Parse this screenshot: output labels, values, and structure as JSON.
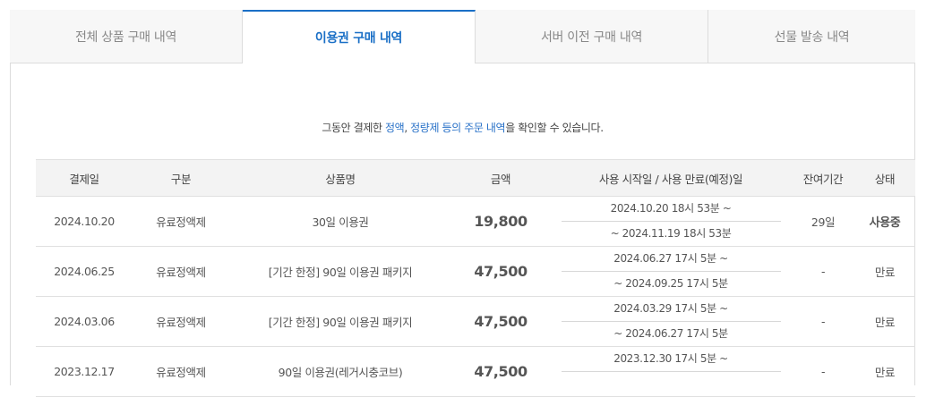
{
  "tabs": [
    {
      "label": "전체 상품 구매 내역",
      "active": false
    },
    {
      "label": "이용권 구매 내역",
      "active": true
    },
    {
      "label": "서버 이전 구매 내역",
      "active": false
    },
    {
      "label": "선물 발송 내역",
      "active": false
    }
  ],
  "notice": {
    "prefix": "그동안 결제한 ",
    "highlight1": "정액",
    "sep": ", ",
    "highlight2": "정량제 등의 주문 내역",
    "suffix": "을 확인할 수 있습니다."
  },
  "table": {
    "headers": [
      "결제일",
      "구분",
      "상품명",
      "금액",
      "사용 시작일 / 사용 만료(예정)일",
      "잔여기간",
      "상태"
    ],
    "rows": [
      {
        "date": "2024.10.20",
        "type": "유료정액제",
        "product": "30일 이용권",
        "amount": "19,800",
        "start": "2024.10.20 18시 53분 ~",
        "end": "~ 2024.11.19 18시 53분",
        "remaining": "29일",
        "status": "사용중",
        "status_kind": "active"
      },
      {
        "date": "2024.06.25",
        "type": "유료정액제",
        "product": "[기간 한정] 90일 이용권 패키지",
        "amount": "47,500",
        "start": "2024.06.27 17시 5분 ~",
        "end": "~ 2024.09.25 17시 5분",
        "remaining": "-",
        "status": "만료",
        "status_kind": "expired"
      },
      {
        "date": "2024.03.06",
        "type": "유료정액제",
        "product": "[기간 한정] 90일 이용권 패키지",
        "amount": "47,500",
        "start": "2024.03.29 17시 5분 ~",
        "end": "~ 2024.06.27 17시 5분",
        "remaining": "-",
        "status": "만료",
        "status_kind": "expired"
      },
      {
        "date": "2023.12.17",
        "type": "유료정액제",
        "product": "90일 이용권(레거시충코브)",
        "amount": "47,500",
        "start": "2023.12.30 17시 5분 ~",
        "end": "",
        "remaining": "-",
        "status": "만료",
        "status_kind": "expired"
      }
    ]
  },
  "colors": {
    "accent": "#1a6fc6",
    "link": "#2a72c8",
    "header_bg": "#f3f3f3",
    "tab_bg": "#f7f7f7"
  }
}
